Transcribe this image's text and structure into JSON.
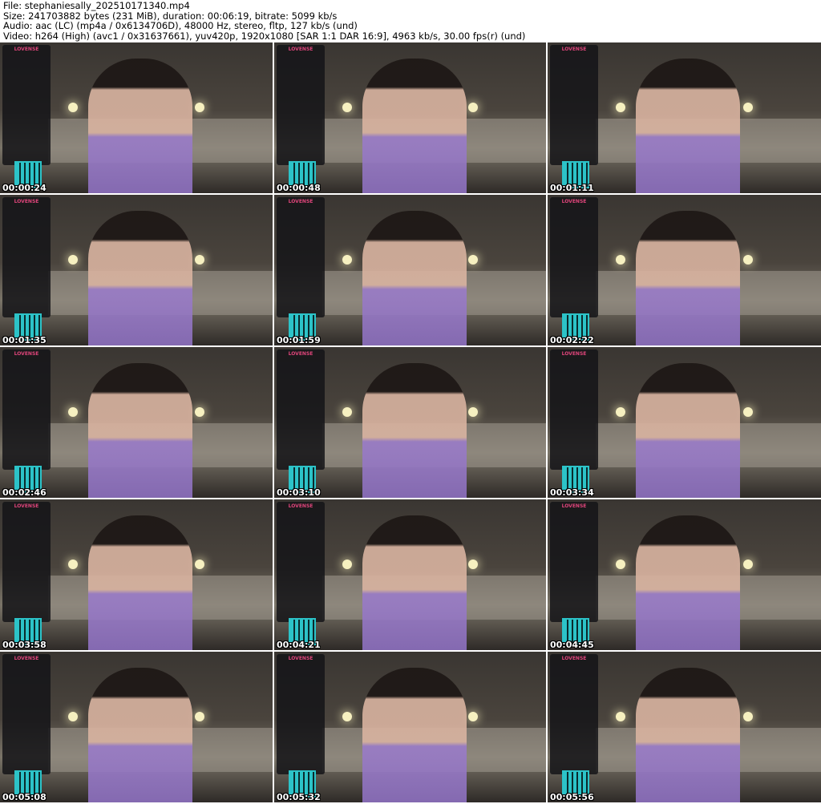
{
  "header": {
    "file": "File: stephaniesally_202510171340.mp4",
    "size": "Size: 241703882 bytes (231 MiB), duration: 00:06:19, bitrate: 5099 kb/s",
    "audio": "Audio: aac (LC) (mp4a / 0x6134706D), 48000 Hz, stereo, fltp, 127 kb/s (und)",
    "video": "Video: h264 (High) (avc1 / 0x31637661), yuv420p, 1920x1080 [SAR 1:1 DAR 16:9], 4963 kb/s, 30.00 fps(r) (und)"
  },
  "overlay_brand": "LOVENSE",
  "thumbnails": [
    {
      "timestamp": "00:00:24"
    },
    {
      "timestamp": "00:00:48"
    },
    {
      "timestamp": "00:01:11"
    },
    {
      "timestamp": "00:01:35"
    },
    {
      "timestamp": "00:01:59"
    },
    {
      "timestamp": "00:02:22"
    },
    {
      "timestamp": "00:02:46"
    },
    {
      "timestamp": "00:03:10"
    },
    {
      "timestamp": "00:03:34"
    },
    {
      "timestamp": "00:03:58"
    },
    {
      "timestamp": "00:04:21"
    },
    {
      "timestamp": "00:04:45"
    },
    {
      "timestamp": "00:05:08"
    },
    {
      "timestamp": "00:05:32"
    },
    {
      "timestamp": "00:05:56"
    }
  ]
}
